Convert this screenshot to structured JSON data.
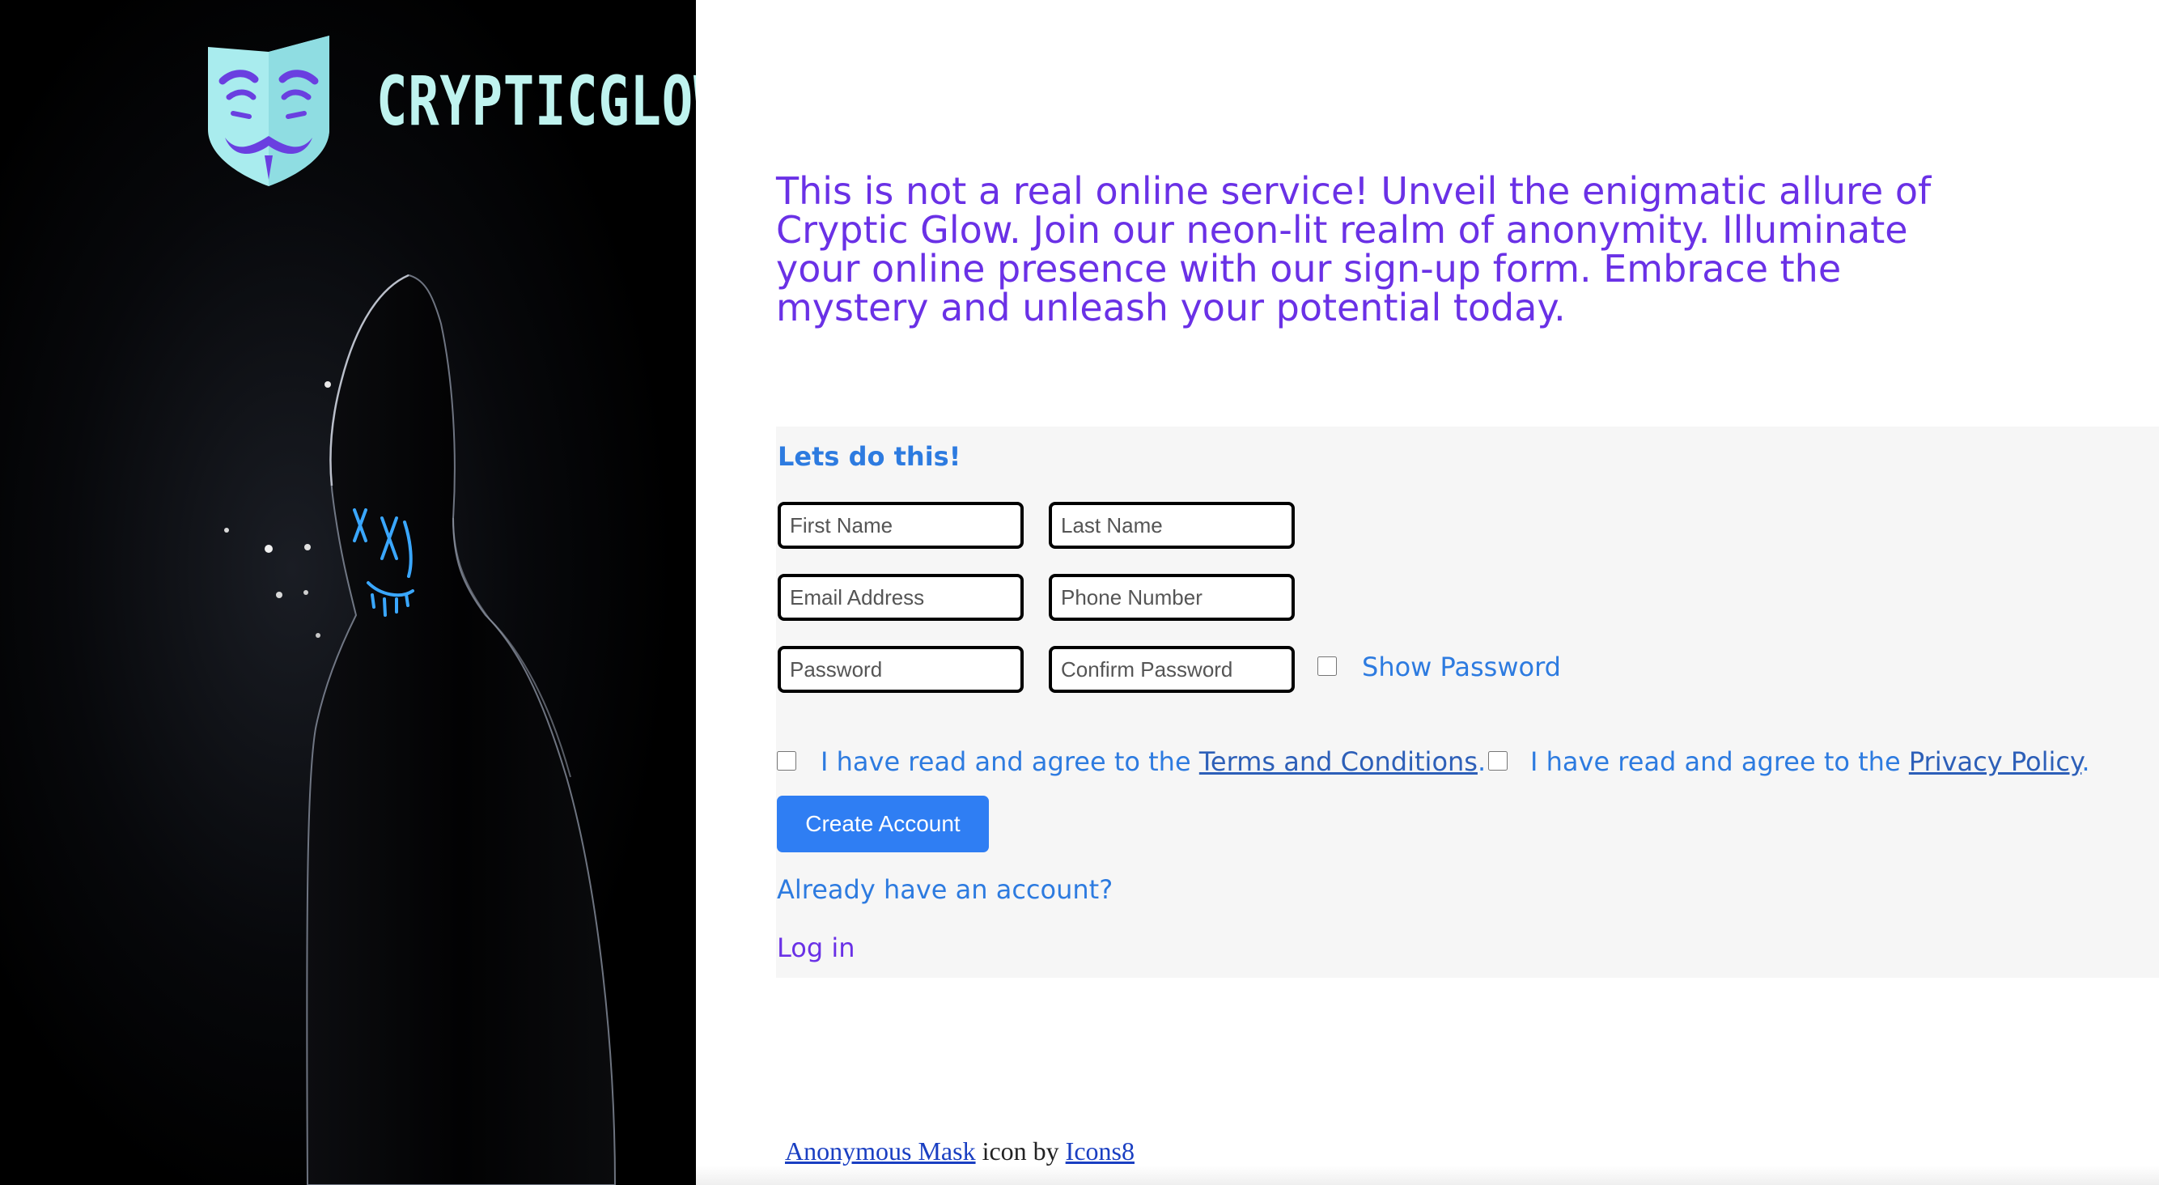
{
  "brand": {
    "name": "CRYPTICGLOW",
    "logo_icon": "anonymous-mask-icon"
  },
  "intro": {
    "text": "This is not a real online service! Unveil the enigmatic allure of Cryptic Glow. Join our neon-lit realm of anonymity. Illuminate your online presence with our sign-up form. Embrace the mystery and unleash your potential today."
  },
  "form": {
    "heading": "Lets do this!",
    "first_name_placeholder": "First Name",
    "last_name_placeholder": "Last Name",
    "email_placeholder": "Email Address",
    "phone_placeholder": "Phone Number",
    "password_placeholder": "Password",
    "confirm_password_placeholder": "Confirm Password",
    "show_password_label": "Show Password",
    "terms_prefix": "I have read and agree to the ",
    "terms_link": "Terms and Conditions",
    "terms_suffix": ".",
    "privacy_prefix": "I have read and agree to the ",
    "privacy_link": "Privacy Policy",
    "privacy_suffix": ".",
    "create_button": "Create Account",
    "already_text": "Already have an account?",
    "login_link": "Log in"
  },
  "credit": {
    "link1": "Anonymous Mask",
    "middle": " icon by ",
    "link2": "Icons8"
  },
  "colors": {
    "accent_purple": "#6a31e6",
    "accent_blue": "#2d7be0",
    "button_blue": "#2f7ef3",
    "panel_bg": "#f6f6f6",
    "hero_bg": "#000000",
    "neon_blue": "#3aa7ff",
    "logo_text": "#bff3ef"
  }
}
